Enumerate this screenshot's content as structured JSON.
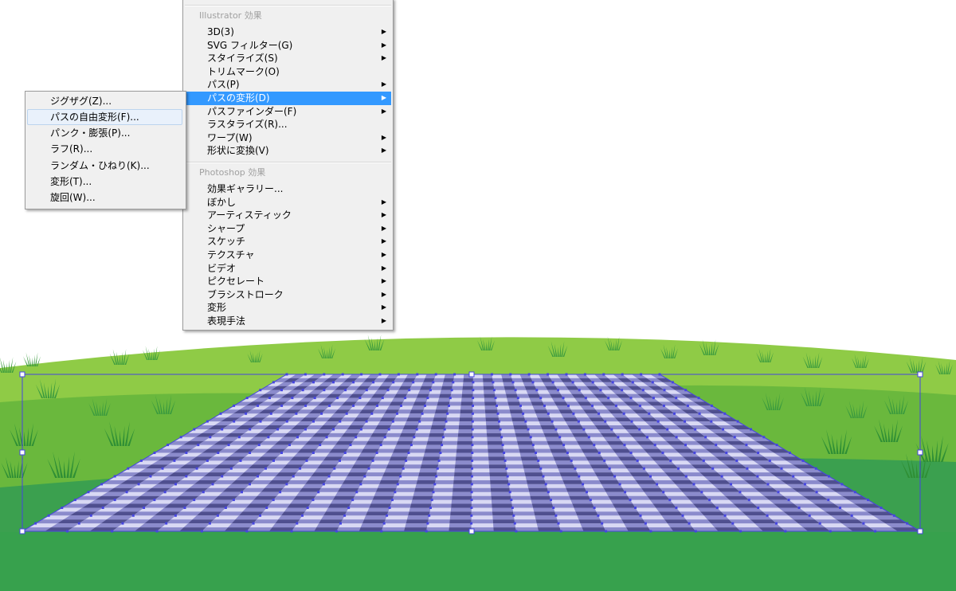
{
  "colors": {
    "grass_light": "#8fcb46",
    "grass_mid": "#6ab83d",
    "grass_dark": "#3ba04f",
    "tuft": "#3a9a3e",
    "check_light": "#d9d9f4",
    "check_mid": "#8b8bcc",
    "check_dark": "#4f4f8f",
    "selection": "#4545e0",
    "menu_bg": "#f0f0f0",
    "menu_highlight": "#3399ff"
  },
  "main_menu": {
    "illustrator_header": "Illustrator 効果",
    "illustrator_items": [
      {
        "label": "3D(3)",
        "submenu": true
      },
      {
        "label": "SVG フィルター(G)",
        "submenu": true
      },
      {
        "label": "スタイライズ(S)",
        "submenu": true
      },
      {
        "label": "トリムマーク(O)",
        "submenu": false
      },
      {
        "label": "パス(P)",
        "submenu": true
      },
      {
        "label": "パスの変形(D)",
        "submenu": true,
        "highlighted": true
      },
      {
        "label": "パスファインダー(F)",
        "submenu": true
      },
      {
        "label": "ラスタライズ(R)...",
        "submenu": false
      },
      {
        "label": "ワープ(W)",
        "submenu": true
      },
      {
        "label": "形状に変換(V)",
        "submenu": true
      }
    ],
    "photoshop_header": "Photoshop 効果",
    "photoshop_items": [
      {
        "label": "効果ギャラリー...",
        "submenu": false
      },
      {
        "label": "ぼかし",
        "submenu": true
      },
      {
        "label": "アーティスティック",
        "submenu": true
      },
      {
        "label": "シャープ",
        "submenu": true
      },
      {
        "label": "スケッチ",
        "submenu": true
      },
      {
        "label": "テクスチャ",
        "submenu": true
      },
      {
        "label": "ビデオ",
        "submenu": true
      },
      {
        "label": "ピクセレート",
        "submenu": true
      },
      {
        "label": "ブラシストローク",
        "submenu": true
      },
      {
        "label": "変形",
        "submenu": true
      },
      {
        "label": "表現手法",
        "submenu": true
      }
    ]
  },
  "sub_menu": {
    "items": [
      {
        "label": "ジグザグ(Z)..."
      },
      {
        "label": "パスの自由変形(F)...",
        "hovered": true
      },
      {
        "label": "パンク・膨張(P)..."
      },
      {
        "label": "ラフ(R)..."
      },
      {
        "label": "ランダム・ひねり(K)..."
      },
      {
        "label": "変形(T)..."
      },
      {
        "label": "旋回(W)..."
      }
    ]
  }
}
